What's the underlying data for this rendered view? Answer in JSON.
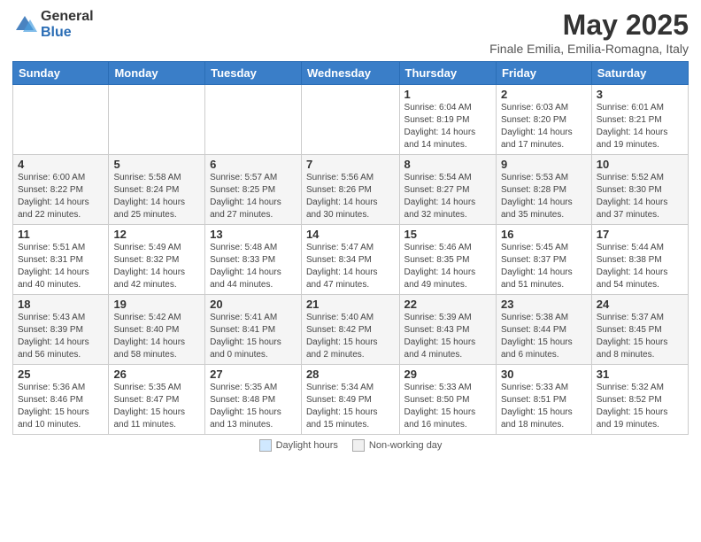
{
  "logo": {
    "general": "General",
    "blue": "Blue"
  },
  "title": "May 2025",
  "location": "Finale Emilia, Emilia-Romagna, Italy",
  "days_of_week": [
    "Sunday",
    "Monday",
    "Tuesday",
    "Wednesday",
    "Thursday",
    "Friday",
    "Saturday"
  ],
  "weeks": [
    [
      {
        "day": "",
        "info": ""
      },
      {
        "day": "",
        "info": ""
      },
      {
        "day": "",
        "info": ""
      },
      {
        "day": "",
        "info": ""
      },
      {
        "day": "1",
        "info": "Sunrise: 6:04 AM\nSunset: 8:19 PM\nDaylight: 14 hours\nand 14 minutes."
      },
      {
        "day": "2",
        "info": "Sunrise: 6:03 AM\nSunset: 8:20 PM\nDaylight: 14 hours\nand 17 minutes."
      },
      {
        "day": "3",
        "info": "Sunrise: 6:01 AM\nSunset: 8:21 PM\nDaylight: 14 hours\nand 19 minutes."
      }
    ],
    [
      {
        "day": "4",
        "info": "Sunrise: 6:00 AM\nSunset: 8:22 PM\nDaylight: 14 hours\nand 22 minutes."
      },
      {
        "day": "5",
        "info": "Sunrise: 5:58 AM\nSunset: 8:24 PM\nDaylight: 14 hours\nand 25 minutes."
      },
      {
        "day": "6",
        "info": "Sunrise: 5:57 AM\nSunset: 8:25 PM\nDaylight: 14 hours\nand 27 minutes."
      },
      {
        "day": "7",
        "info": "Sunrise: 5:56 AM\nSunset: 8:26 PM\nDaylight: 14 hours\nand 30 minutes."
      },
      {
        "day": "8",
        "info": "Sunrise: 5:54 AM\nSunset: 8:27 PM\nDaylight: 14 hours\nand 32 minutes."
      },
      {
        "day": "9",
        "info": "Sunrise: 5:53 AM\nSunset: 8:28 PM\nDaylight: 14 hours\nand 35 minutes."
      },
      {
        "day": "10",
        "info": "Sunrise: 5:52 AM\nSunset: 8:30 PM\nDaylight: 14 hours\nand 37 minutes."
      }
    ],
    [
      {
        "day": "11",
        "info": "Sunrise: 5:51 AM\nSunset: 8:31 PM\nDaylight: 14 hours\nand 40 minutes."
      },
      {
        "day": "12",
        "info": "Sunrise: 5:49 AM\nSunset: 8:32 PM\nDaylight: 14 hours\nand 42 minutes."
      },
      {
        "day": "13",
        "info": "Sunrise: 5:48 AM\nSunset: 8:33 PM\nDaylight: 14 hours\nand 44 minutes."
      },
      {
        "day": "14",
        "info": "Sunrise: 5:47 AM\nSunset: 8:34 PM\nDaylight: 14 hours\nand 47 minutes."
      },
      {
        "day": "15",
        "info": "Sunrise: 5:46 AM\nSunset: 8:35 PM\nDaylight: 14 hours\nand 49 minutes."
      },
      {
        "day": "16",
        "info": "Sunrise: 5:45 AM\nSunset: 8:37 PM\nDaylight: 14 hours\nand 51 minutes."
      },
      {
        "day": "17",
        "info": "Sunrise: 5:44 AM\nSunset: 8:38 PM\nDaylight: 14 hours\nand 54 minutes."
      }
    ],
    [
      {
        "day": "18",
        "info": "Sunrise: 5:43 AM\nSunset: 8:39 PM\nDaylight: 14 hours\nand 56 minutes."
      },
      {
        "day": "19",
        "info": "Sunrise: 5:42 AM\nSunset: 8:40 PM\nDaylight: 14 hours\nand 58 minutes."
      },
      {
        "day": "20",
        "info": "Sunrise: 5:41 AM\nSunset: 8:41 PM\nDaylight: 15 hours\nand 0 minutes."
      },
      {
        "day": "21",
        "info": "Sunrise: 5:40 AM\nSunset: 8:42 PM\nDaylight: 15 hours\nand 2 minutes."
      },
      {
        "day": "22",
        "info": "Sunrise: 5:39 AM\nSunset: 8:43 PM\nDaylight: 15 hours\nand 4 minutes."
      },
      {
        "day": "23",
        "info": "Sunrise: 5:38 AM\nSunset: 8:44 PM\nDaylight: 15 hours\nand 6 minutes."
      },
      {
        "day": "24",
        "info": "Sunrise: 5:37 AM\nSunset: 8:45 PM\nDaylight: 15 hours\nand 8 minutes."
      }
    ],
    [
      {
        "day": "25",
        "info": "Sunrise: 5:36 AM\nSunset: 8:46 PM\nDaylight: 15 hours\nand 10 minutes."
      },
      {
        "day": "26",
        "info": "Sunrise: 5:35 AM\nSunset: 8:47 PM\nDaylight: 15 hours\nand 11 minutes."
      },
      {
        "day": "27",
        "info": "Sunrise: 5:35 AM\nSunset: 8:48 PM\nDaylight: 15 hours\nand 13 minutes."
      },
      {
        "day": "28",
        "info": "Sunrise: 5:34 AM\nSunset: 8:49 PM\nDaylight: 15 hours\nand 15 minutes."
      },
      {
        "day": "29",
        "info": "Sunrise: 5:33 AM\nSunset: 8:50 PM\nDaylight: 15 hours\nand 16 minutes."
      },
      {
        "day": "30",
        "info": "Sunrise: 5:33 AM\nSunset: 8:51 PM\nDaylight: 15 hours\nand 18 minutes."
      },
      {
        "day": "31",
        "info": "Sunrise: 5:32 AM\nSunset: 8:52 PM\nDaylight: 15 hours\nand 19 minutes."
      }
    ]
  ],
  "footer": {
    "legend1": "Daylight hours",
    "legend2": "Non-working day"
  }
}
